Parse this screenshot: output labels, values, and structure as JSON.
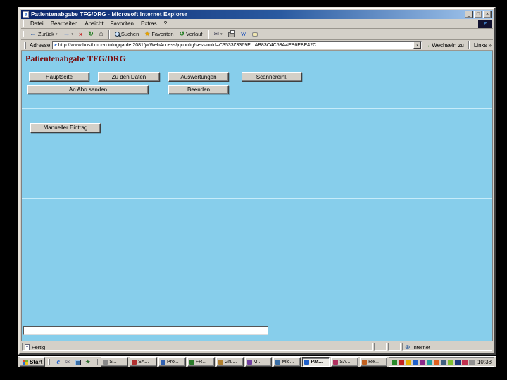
{
  "window": {
    "title": "Patientenabgabe TFG/DRG - Microsoft Internet Explorer"
  },
  "menubar": {
    "items": [
      "Datei",
      "Bearbeiten",
      "Ansicht",
      "Favoriten",
      "Extras",
      "?"
    ]
  },
  "toolbar": {
    "back_label": "Zurück",
    "search_label": "Suchen",
    "favorites_label": "Favoriten",
    "history_label": "Verlauf"
  },
  "addressbar": {
    "label": "Adresse",
    "url": "http://www.hostl.mcr-n.infogqa.de:2081/jwWebAccess/jqconfig/sessionId=C353373369EL.AB83C4C53A4EB6EBE42C",
    "go_label": "Wechseln zu",
    "links_label": "Links"
  },
  "page": {
    "heading": "Patientenabgabe TFG/DRG",
    "nav_row1": [
      "Hauptseite",
      "Zu den Daten",
      "Auswertungen",
      "Scannereinl."
    ],
    "nav_row2": [
      "An Abo senden",
      "Beenden"
    ],
    "manual_label": "Manueller Eintrag",
    "input_value": ""
  },
  "statusbar": {
    "status": "Fertig",
    "zone": "Internet"
  },
  "taskbar": {
    "start_label": "Start",
    "tasks": [
      "S...",
      "SA...",
      "Pro...",
      "FR...",
      "Gru...",
      "M...",
      "Mic...",
      "Pat...",
      "SA...",
      "Re..."
    ],
    "active_task_index": 7,
    "clock": "10:38"
  },
  "colors": {
    "content_background": "#87ceeb",
    "heading_color": "#7a0c0c",
    "chrome": "#d4d0c8",
    "titlebar_start": "#0a246a",
    "titlebar_end": "#a6caf0"
  },
  "icons": {
    "ie_e": "e",
    "minimize": "_",
    "maximize": "□",
    "close": "×",
    "dropdown": "▾",
    "back_arrow": "←",
    "forward_arrow": "→",
    "stop": "×",
    "refresh": "↻",
    "home": "⌂",
    "favorites_star": "★",
    "history": "↺",
    "mail": "✉",
    "edit_w": "W",
    "go_arrow": "→",
    "links_chevron": "»",
    "globe": "⊕"
  }
}
